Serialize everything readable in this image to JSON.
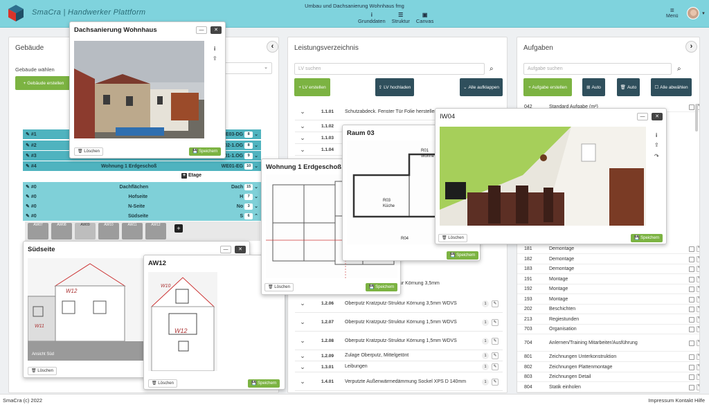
{
  "header": {
    "brand": "SmaCra | Handwerker Plattform",
    "project": "Umbau und Dachsanierung Wohnhaus fmg",
    "nav": [
      {
        "icon": "info-icon",
        "label": "Grunddaten"
      },
      {
        "icon": "structure-icon",
        "label": "Struktur"
      },
      {
        "icon": "image-icon",
        "label": "Canvas"
      }
    ],
    "menu_label": "Menü"
  },
  "gebaeude": {
    "title": "Gebäude",
    "select_label": "Gebäude wählen",
    "create_btn": "+ Gebäude erstellen",
    "floors": [
      {
        "label": "#1",
        "code": "E03-DG",
        "count": "8"
      },
      {
        "label": "#2",
        "code": "E02-1.OG",
        "count": "8"
      },
      {
        "label": "#3",
        "code": "E01-1.OG",
        "count": "9"
      },
      {
        "label": "#4",
        "name": "Wohnung 1 Erdgeschoß",
        "code": "WE01-EG",
        "count": "10"
      }
    ],
    "etage_label": "Etage",
    "areas": [
      {
        "label": "#0",
        "name": "Dachflächen",
        "code": "Dach",
        "count": "15"
      },
      {
        "label": "#0",
        "name": "Hofseite",
        "code": "H",
        "count": "7"
      },
      {
        "label": "#0",
        "name": "N-Seite",
        "code": "No",
        "count": "3"
      },
      {
        "label": "#0",
        "name": "Südseite",
        "code": "S",
        "count": "6"
      }
    ],
    "tiles": [
      "AW07",
      "AW08",
      "AW09",
      "AW10",
      "AW11",
      "AW12"
    ]
  },
  "lv": {
    "title": "Leistungsverzeichnis",
    "search_placeholder": "LV suchen",
    "btn_create": "+ LV erstellen",
    "btn_upload": "LV hochladen",
    "btn_expand": "Alle aufklappen",
    "rows_top": [
      {
        "code": "1.1.01",
        "desc": "Schutzabdeck. Fenster Tür Folie herstellen beseitigen"
      },
      {
        "code": "1.1.02",
        "desc": ""
      },
      {
        "code": "1.1.03",
        "desc": ""
      },
      {
        "code": "1.1.04",
        "desc": ""
      }
    ],
    "rows_bottom": [
      {
        "code": "1.2.06",
        "desc": "Oberputz Kratzputz-Struktur Körnung 3,5mm WDVS",
        "count": "1"
      },
      {
        "code": "1.2.07",
        "desc": "Oberputz Kratzputz-Struktur Körnung 1,5mm WDVS",
        "count": "1"
      },
      {
        "code": "1.2.08",
        "desc": "Oberputz Kratzputz-Struktur Körnung 1,5mm WDVS",
        "count": "1"
      },
      {
        "code": "1.2.09",
        "desc": "Zulage Oberputz, Mittelgetönt",
        "count": "1"
      },
      {
        "code": "1.3.01",
        "desc": "Leibungen",
        "count": "1"
      },
      {
        "code": "1.4.01",
        "desc": "Verputzte Außenwärmedämmung Sockel XPS D 140mm",
        "count": "1"
      }
    ],
    "partial_row": "Oberputz Kratzputz-Struktur Körnung 3,5mm"
  },
  "aufgaben": {
    "title": "Aufgaben",
    "search_placeholder": "Aufgabe suchen",
    "btn_create": "+ Aufgabe erstellen",
    "btn_auto1": "Auto",
    "btn_auto2": "Auto",
    "btn_deselect": "Alle abwählen",
    "rows_top": [
      {
        "num": "042",
        "name": "Standard Aufgabe (m²)"
      }
    ],
    "rows": [
      {
        "num": "181",
        "name": "Demontage"
      },
      {
        "num": "182",
        "name": "Demontage"
      },
      {
        "num": "183",
        "name": "Demontage"
      },
      {
        "num": "191",
        "name": "Montage"
      },
      {
        "num": "192",
        "name": "Montage"
      },
      {
        "num": "193",
        "name": "Montage"
      },
      {
        "num": "202",
        "name": "Beschichten"
      },
      {
        "num": "213",
        "name": "Regiestunden"
      },
      {
        "num": "703",
        "name": "Organisation"
      },
      {
        "num": "704",
        "name": "Anlernen/Training Mitarbeiter/Ausführung"
      },
      {
        "num": "801",
        "name": "Zeichnungen Unterkonstruktion"
      },
      {
        "num": "802",
        "name": "Zeichnungen Plattenmontage"
      },
      {
        "num": "803",
        "name": "Zeichnungen Detail"
      },
      {
        "num": "804",
        "name": "Statik einholen"
      }
    ]
  },
  "windows": {
    "dach": {
      "title": "Dachsanierung Wohnhaus",
      "delete": "Löschen",
      "save": "Speichern"
    },
    "sued": {
      "title": "Südseite",
      "caption": "Ansicht Süd",
      "delete": "Löschen"
    },
    "aw12": {
      "title": "AW12",
      "delete": "Löschen",
      "save": "Speichern"
    },
    "wohnung": {
      "title": "Wohnung 1 Erdgeschoß",
      "delete": "Löschen",
      "save": "Speichern"
    },
    "raum": {
      "title": "Raum 03",
      "delete": "Löschen",
      "save": "Speichern",
      "labels": [
        "R01",
        "Wohne",
        "R03",
        "Küche",
        "R04"
      ]
    },
    "iw04": {
      "title": "IW04",
      "delete": "Löschen",
      "save": "Speichern"
    }
  },
  "footer": {
    "copyright": "SmaCra (c) 2022",
    "links": "Impressum Kontakt Hilfe"
  },
  "colors": {
    "accent": "#7fd3dd",
    "green": "#7cb342",
    "dark": "#2f4f5c",
    "floor": "#4fb3bf"
  }
}
